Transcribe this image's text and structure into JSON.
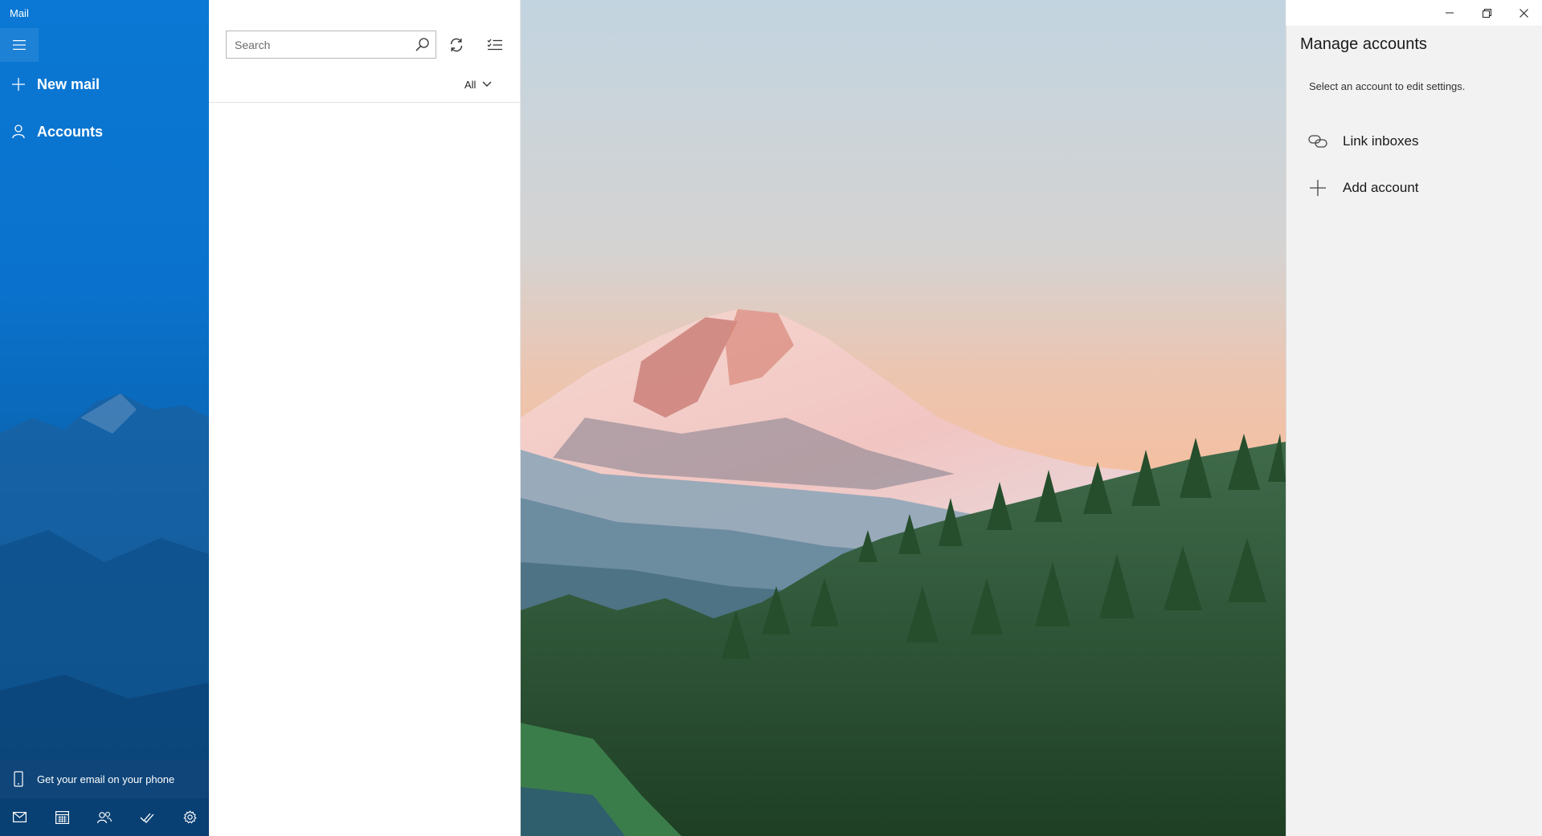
{
  "app": {
    "title": "Mail"
  },
  "nav": {
    "new_mail_label": "New mail",
    "accounts_label": "Accounts",
    "phone_promo_label": "Get your email on your phone",
    "bottom_icons": [
      "mail-icon",
      "calendar-icon",
      "people-icon",
      "todo-icon",
      "settings-icon"
    ]
  },
  "list": {
    "search_placeholder": "Search",
    "filter_label": "All"
  },
  "panel": {
    "title": "Manage accounts",
    "subtitle": "Select an account to edit settings.",
    "link_inboxes_label": "Link inboxes",
    "add_account_label": "Add account"
  },
  "colors": {
    "accent": "#0a78d4",
    "panel_bg": "#f2f2f2"
  }
}
